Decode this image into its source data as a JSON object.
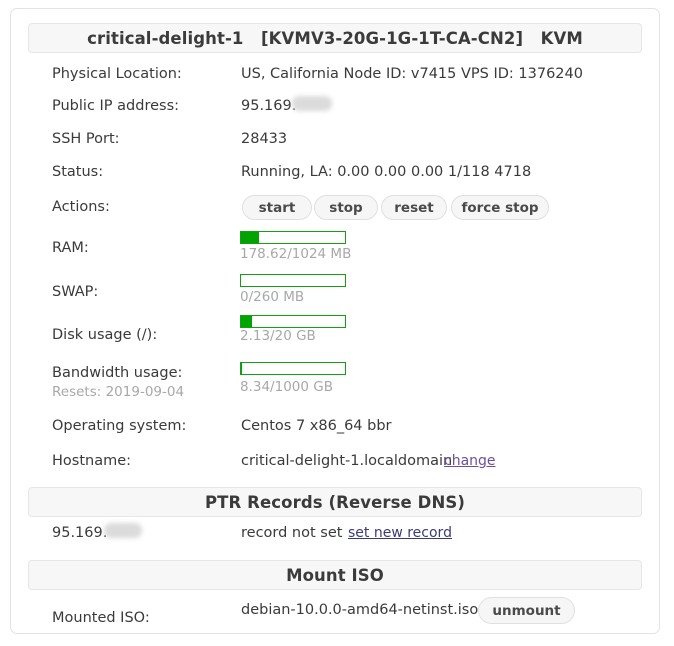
{
  "header": {
    "hostname": "critical-delight-1",
    "plan": "[KVMV3-20G-1G-1T-CA-CN2]",
    "type": "KVM",
    "full_title": "critical-delight-1   [KVMV3-20G-1G-1T-CA-CN2]   KVM"
  },
  "details": {
    "physical_location": {
      "label": "Physical Location:",
      "value": "US, California    Node ID: v7415    VPS ID: 1376240",
      "location": "US, California",
      "node_id": "Node ID: v7415",
      "vps_id": "VPS ID: 1376240"
    },
    "public_ip": {
      "label": "Public IP address:",
      "value": "95.169."
    },
    "ssh_port": {
      "label": "SSH Port:",
      "value": "28433"
    },
    "status": {
      "label": "Status:",
      "value": "Running, LA: 0.00 0.00 0.00 1/118 4718"
    },
    "actions": {
      "label": "Actions:",
      "buttons": [
        {
          "name": "start",
          "label": "start"
        },
        {
          "name": "stop",
          "label": "stop"
        },
        {
          "name": "reset",
          "label": "reset"
        },
        {
          "name": "force-stop",
          "label": "force stop"
        }
      ]
    },
    "ram": {
      "label": "RAM:",
      "text": "178.62/1024 MB",
      "used": 178.62,
      "total": 1024,
      "percent": 17.4
    },
    "swap": {
      "label": "SWAP:",
      "text": "0/260 MB",
      "used": 0,
      "total": 260,
      "percent": 0
    },
    "disk": {
      "label": "Disk usage (/):",
      "text": "2.13/20 GB",
      "used": 2.13,
      "total": 20,
      "percent": 10.7
    },
    "bandwidth": {
      "label": "Bandwidth usage:",
      "reset_label": "Resets: 2019-09-04",
      "text": "8.34/1000 GB",
      "used": 8.34,
      "total": 1000,
      "percent": 0.8
    },
    "operating_system": {
      "label": "Operating system:",
      "value": "Centos 7 x86_64 bbr"
    },
    "hostname_row": {
      "label": "Hostname:",
      "value": "critical-delight-1.localdomain",
      "change_link": "change"
    }
  },
  "ptr": {
    "section_title": "PTR Records (Reverse DNS)",
    "ip": "95.169.",
    "status": "record not set",
    "set_link": "set new record"
  },
  "iso": {
    "section_title": "Mount ISO",
    "label": "Mounted ISO:",
    "value": "debian-10.0.0-amd64-netinst.iso",
    "unmount_label": "unmount"
  },
  "colors": {
    "meter_green": "#00a400",
    "meter_border": "#14a014",
    "panel_bg": "#f7f7f7",
    "text": "#3a3a3a",
    "muted": "#a8a8a8",
    "link_visited": "#6b4fa0",
    "link": "#3b3b7a"
  }
}
